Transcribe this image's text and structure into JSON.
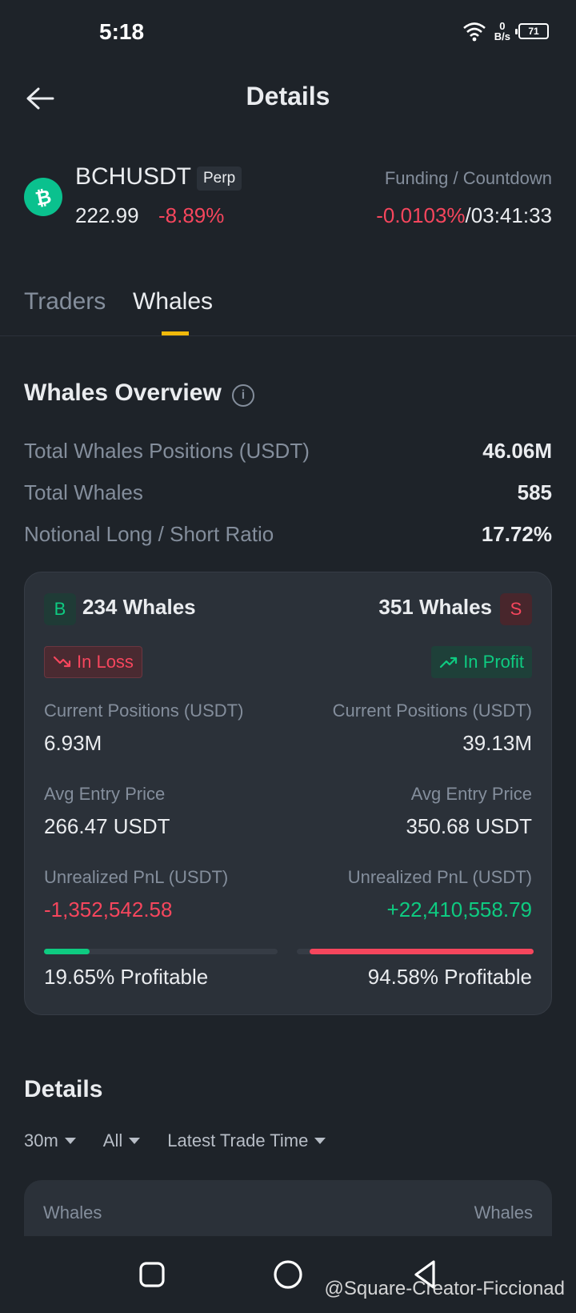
{
  "status_bar": {
    "time": "5:18",
    "net_speed_value": "0",
    "net_speed_unit": "B/s",
    "battery": "71"
  },
  "header": {
    "title": "Details"
  },
  "ticker": {
    "symbol": "BCHUSDT",
    "badge": "Perp",
    "price": "222.99",
    "change": "-8.89%",
    "funding_label": "Funding / Countdown",
    "funding_rate": "-0.0103%",
    "separator": "/",
    "countdown": "03:41:33"
  },
  "tabs": [
    {
      "label": "Traders"
    },
    {
      "label": "Whales"
    }
  ],
  "overview": {
    "title": "Whales Overview",
    "stats": [
      {
        "label": "Total Whales Positions (USDT)",
        "value": "46.06M"
      },
      {
        "label": "Total Whales",
        "value": "585"
      },
      {
        "label": "Notional Long / Short Ratio",
        "value": "17.72%"
      }
    ]
  },
  "card": {
    "long": {
      "badge": "B",
      "count": "234 Whales",
      "status": "In Loss",
      "positions_label": "Current Positions (USDT)",
      "positions_value": "6.93M",
      "entry_label": "Avg Entry Price",
      "entry_value": "266.47 USDT",
      "pnl_label": "Unrealized PnL (USDT)",
      "pnl_value": "-1,352,542.58",
      "profitable_text": "19.65% Profitable",
      "profitable_pct": 19.65
    },
    "short": {
      "badge": "S",
      "count": "351 Whales",
      "status": "In Profit",
      "positions_label": "Current Positions (USDT)",
      "positions_value": "39.13M",
      "entry_label": "Avg Entry Price",
      "entry_value": "350.68 USDT",
      "pnl_label": "Unrealized PnL (USDT)",
      "pnl_value": "+22,410,558.79",
      "profitable_text": "94.58% Profitable",
      "profitable_pct": 94.58
    },
    "colors": {
      "long": "#0ecb81",
      "short": "#f6465d"
    }
  },
  "details": {
    "title": "Details",
    "filters": [
      {
        "label": "30m"
      },
      {
        "label": "All"
      },
      {
        "label": "Latest Trade Time"
      }
    ],
    "header_left": "Whales",
    "header_right": "Whales"
  },
  "watermark": "@Square-Creator-Ficcionad"
}
